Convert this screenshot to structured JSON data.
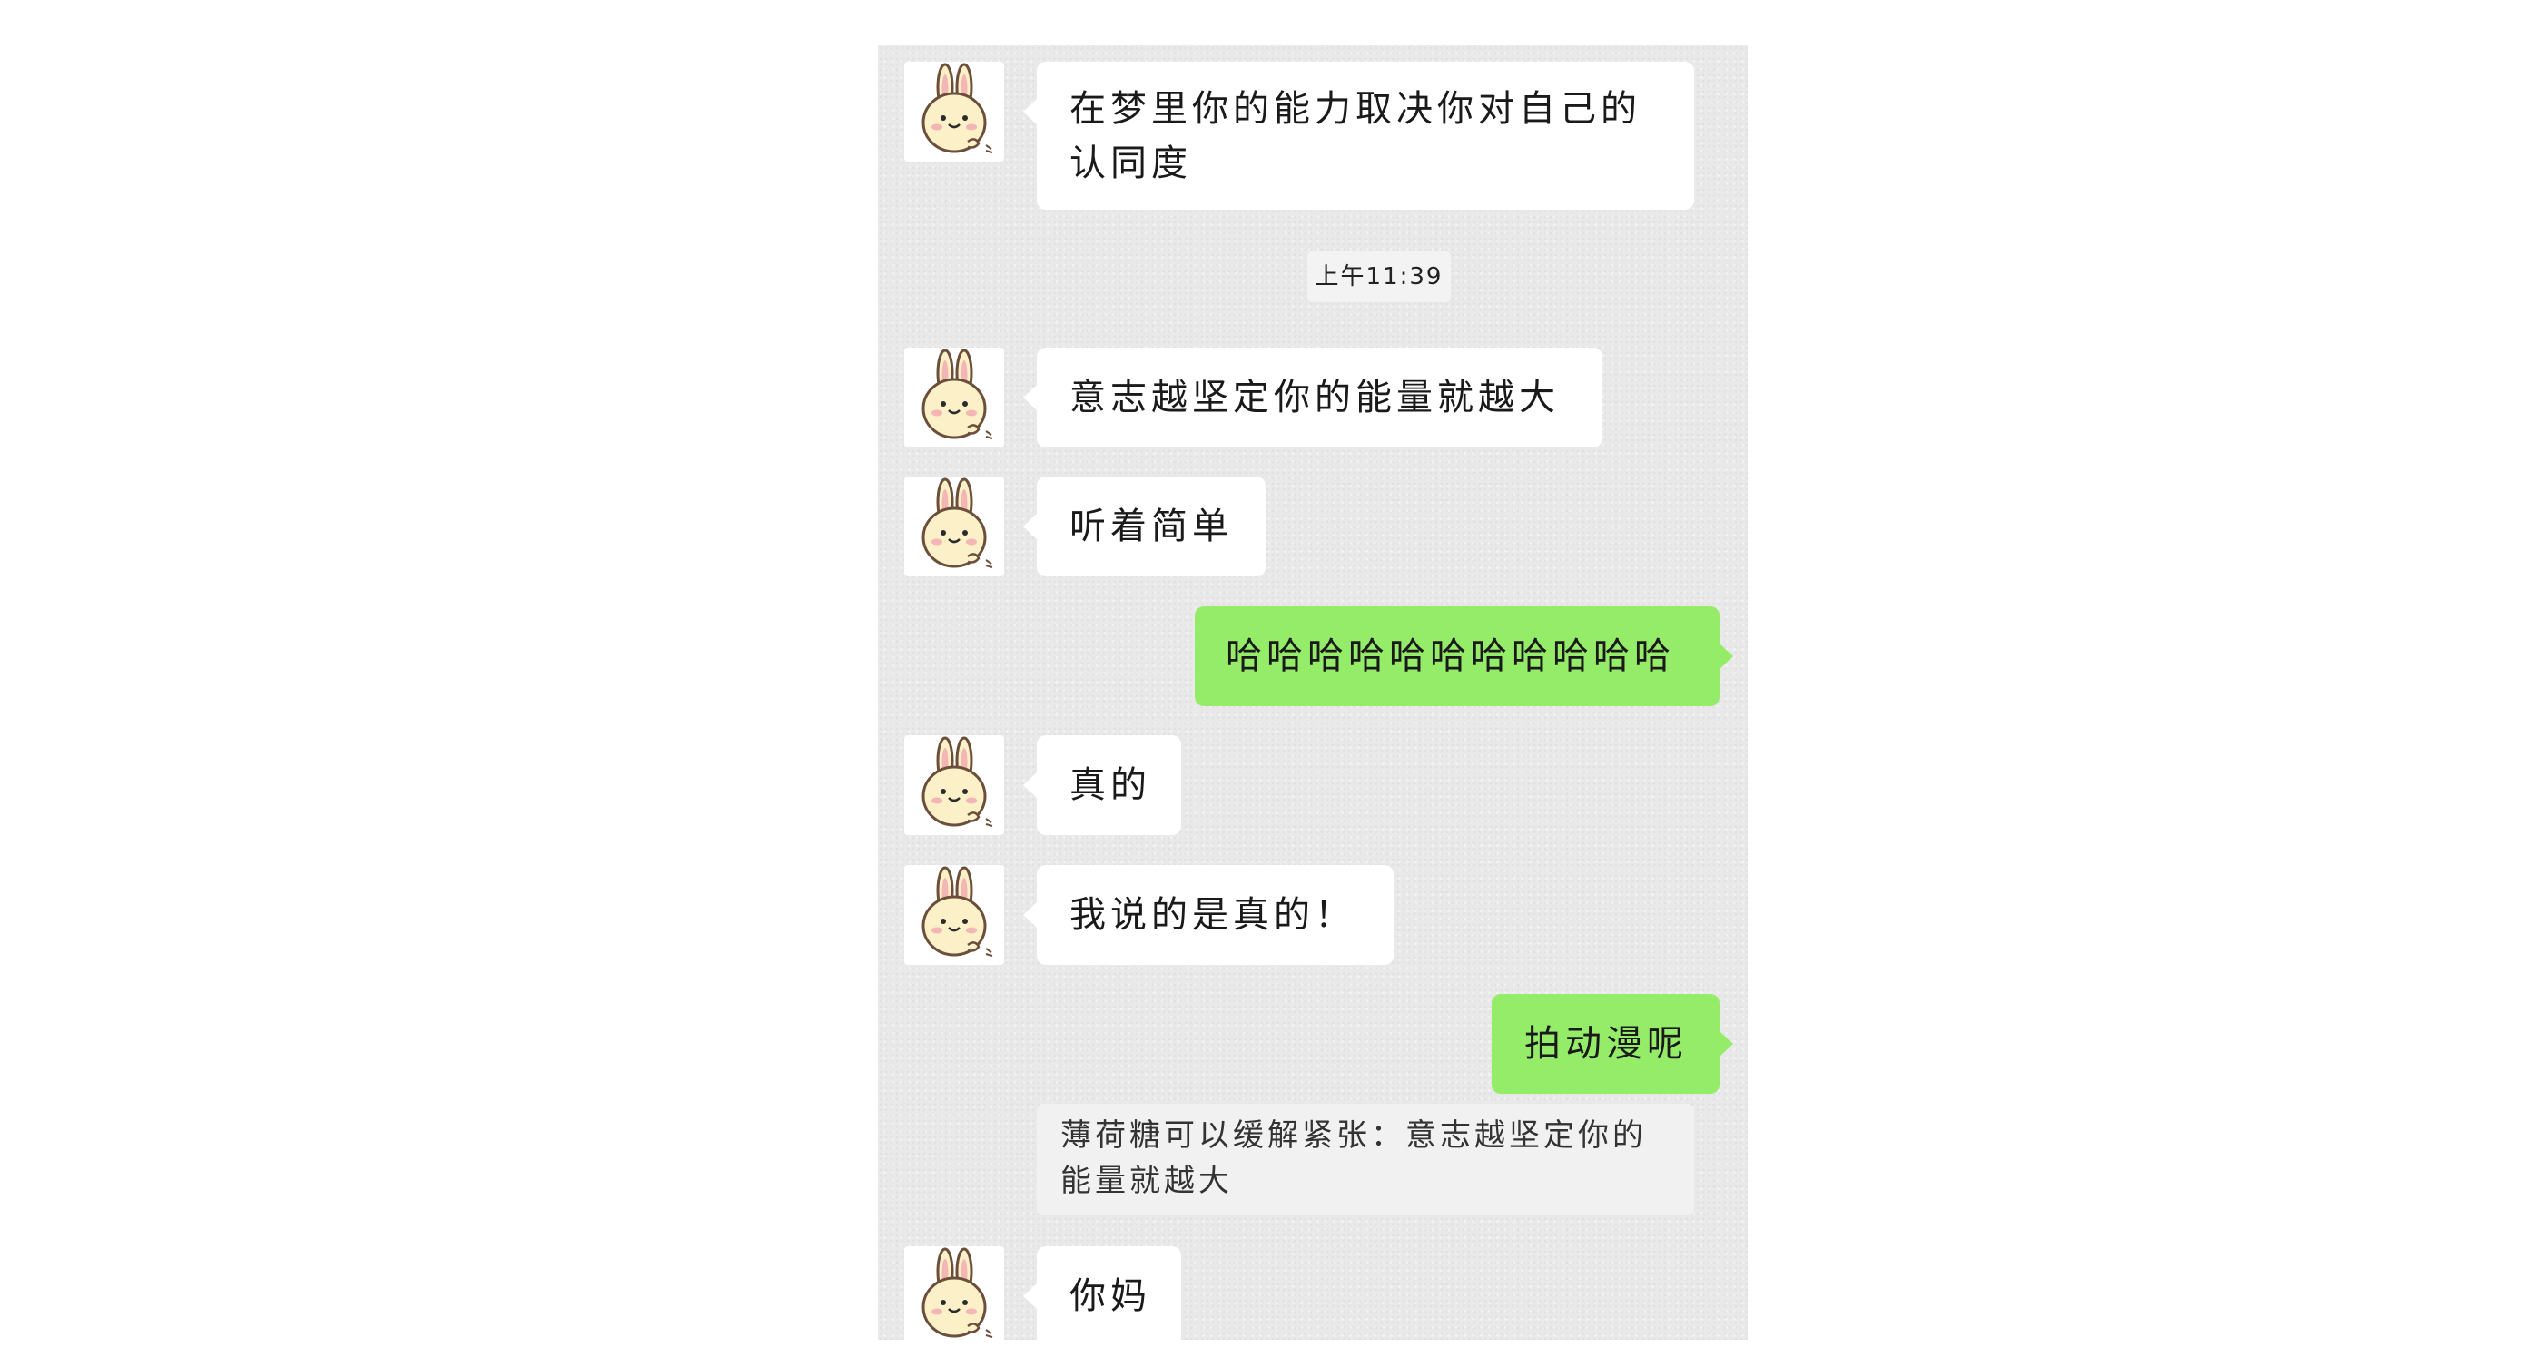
{
  "timestamp": "上午11:39",
  "messages": [
    {
      "side": "in",
      "text": "在梦里你的能力取决你对自己的认同度"
    },
    {
      "side": "in",
      "text": "意志越坚定你的能量就越大"
    },
    {
      "side": "in",
      "text": "听着简单"
    },
    {
      "side": "out",
      "text": "哈哈哈哈哈哈哈哈哈哈哈"
    },
    {
      "side": "in",
      "text": "真的"
    },
    {
      "side": "in",
      "text": "我说的是真的！"
    },
    {
      "side": "out",
      "text": "拍动漫呢"
    },
    {
      "side": "in",
      "text": "你妈"
    }
  ],
  "quote": {
    "text": "薄荷糖可以缓解紧张：意志越坚定你的能量就越大"
  },
  "colors": {
    "background": "#e9e9e9",
    "incoming_bubble": "#ffffff",
    "outgoing_bubble": "#95ec69"
  },
  "icons": {
    "contact_avatar": "cartoon-rabbit-icon"
  }
}
